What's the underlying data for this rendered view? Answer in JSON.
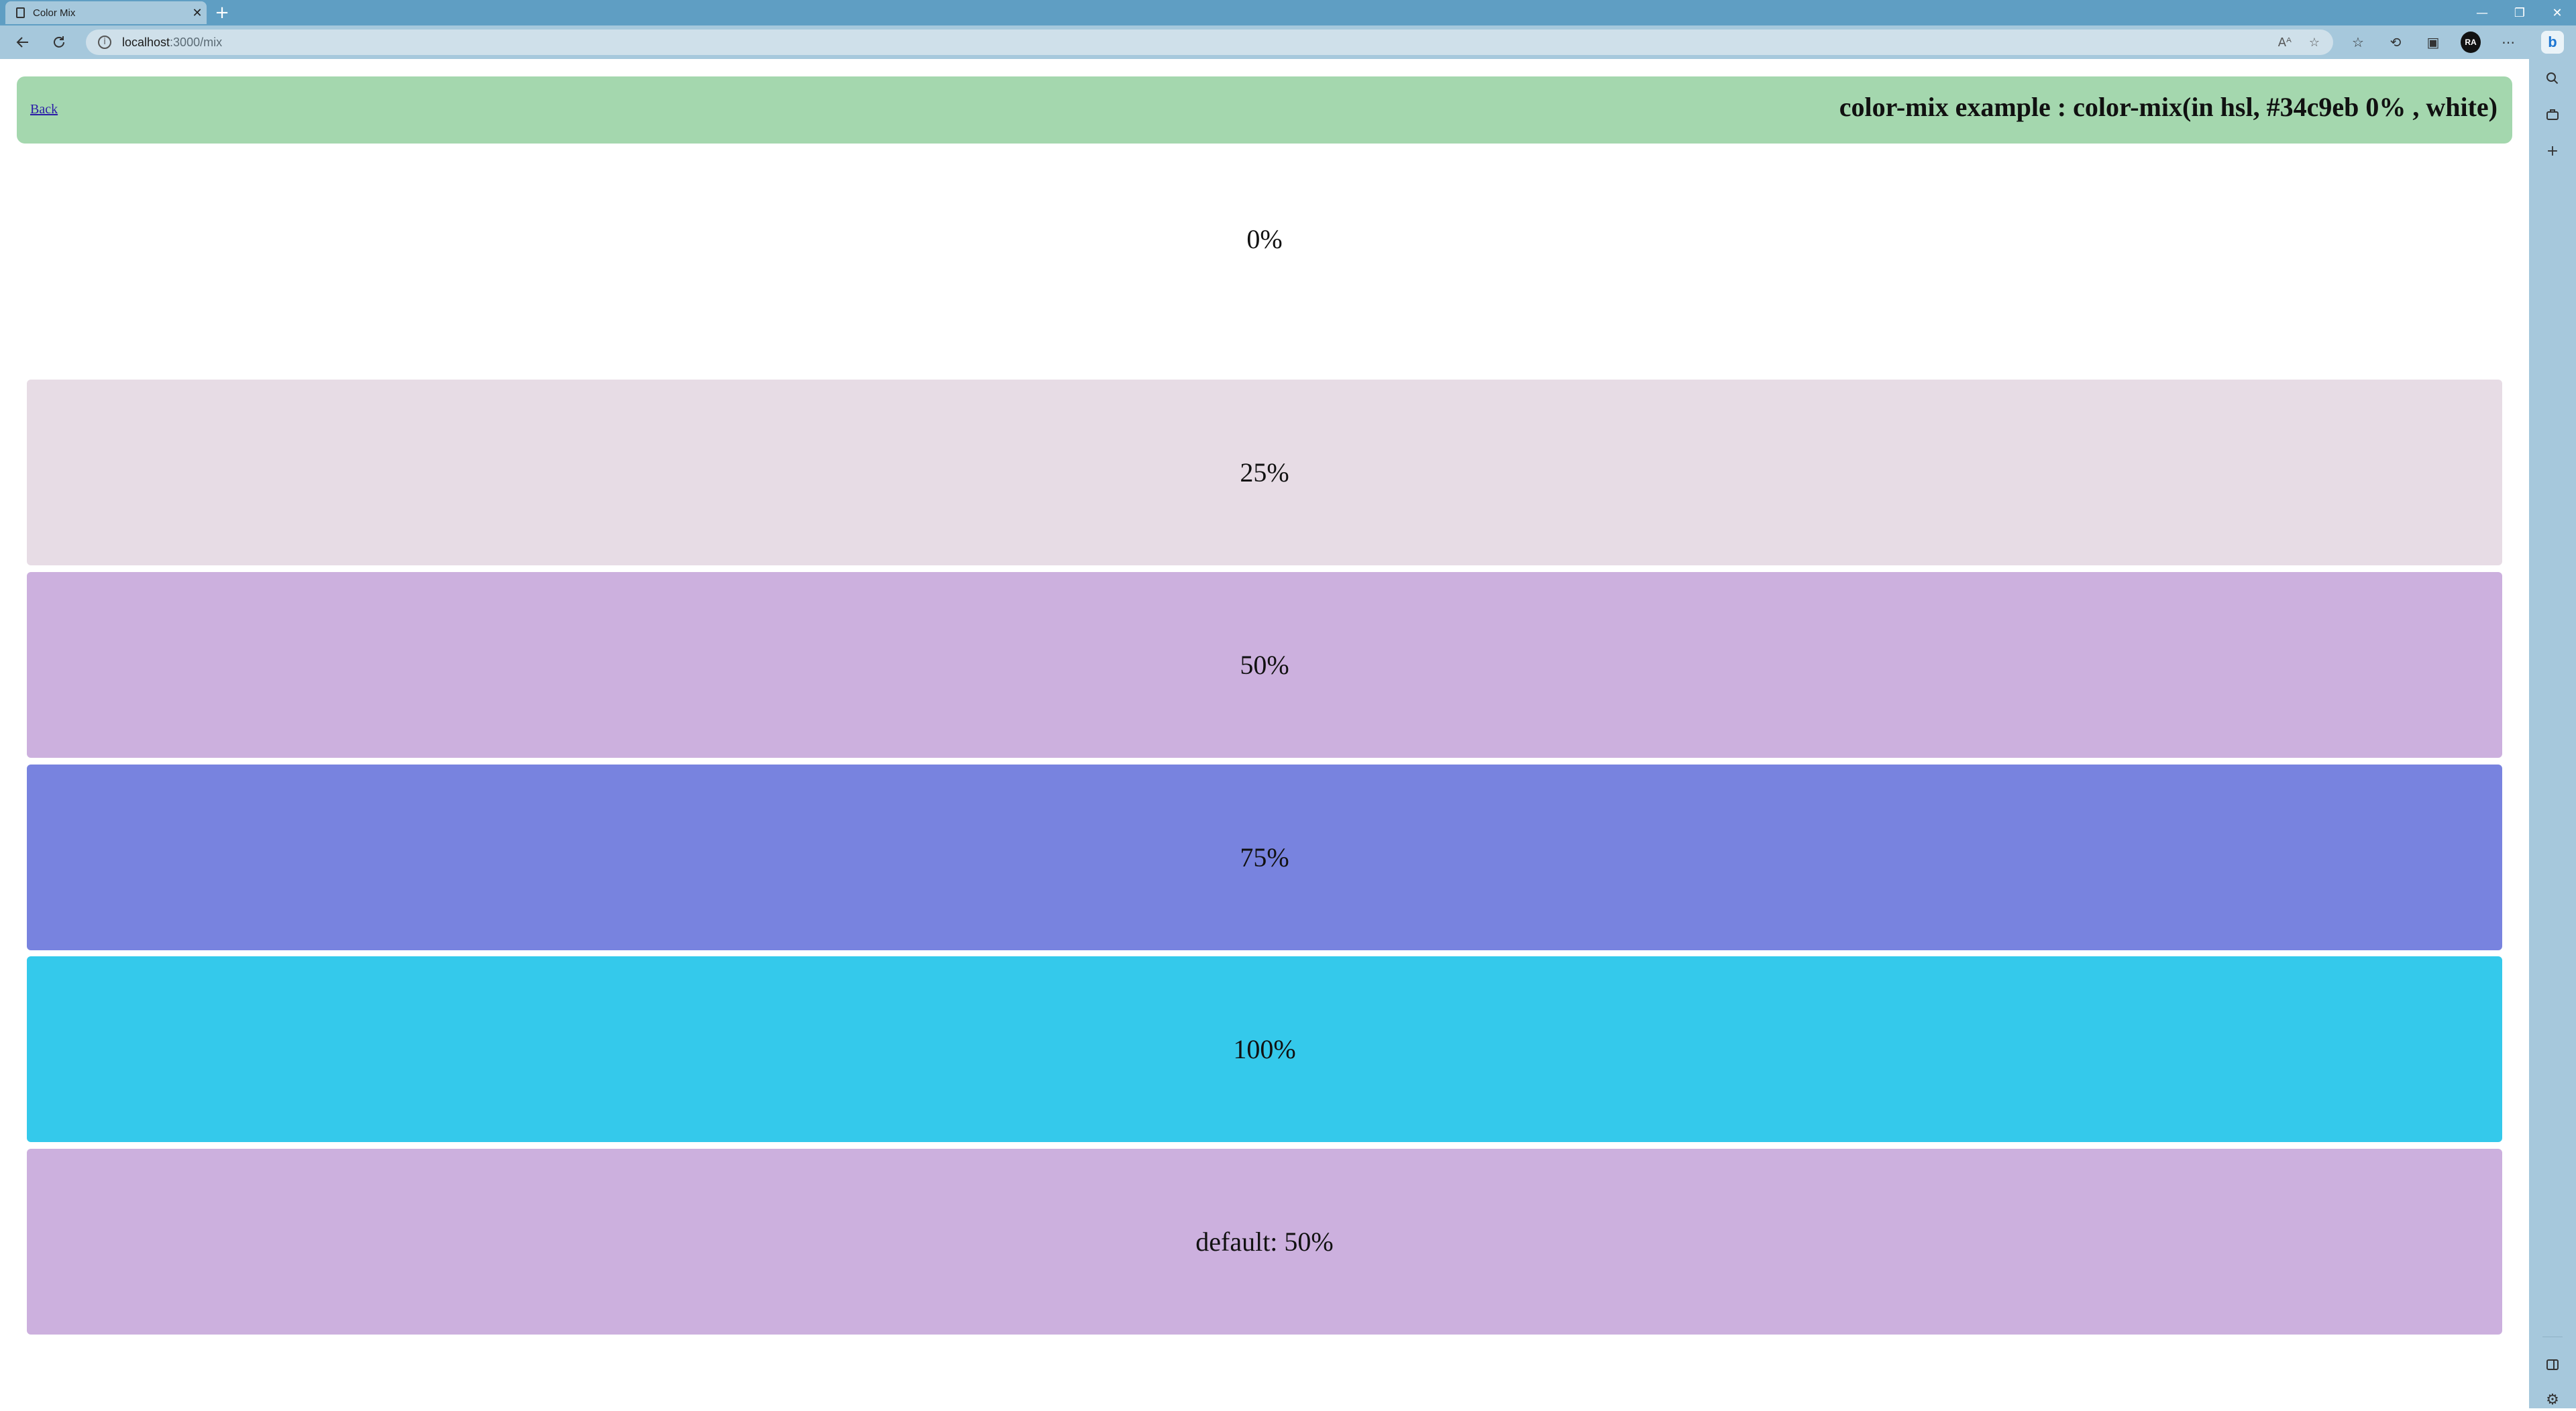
{
  "browser": {
    "tab_title": "Color Mix",
    "tab_close": "✕",
    "new_tab": "+",
    "url_host": "localhost",
    "url_path": ":3000/mix",
    "avatar_initials": "RA",
    "window_controls": [
      "—",
      "❐",
      "✕"
    ],
    "rail_logo": "b"
  },
  "header": {
    "back_label": "Back",
    "title": "color-mix example : color-mix(in hsl, #34c9eb 0% , white)"
  },
  "swatches": [
    {
      "label": "0%",
      "color": "#ffffff"
    },
    {
      "label": "25%",
      "color": "#e7dce5"
    },
    {
      "label": "50%",
      "color": "#ccb0de"
    },
    {
      "label": "75%",
      "color": "#7883df"
    },
    {
      "label": "100%",
      "color": "#34c9eb"
    },
    {
      "label": "default: 50%",
      "color": "#ccb0de"
    }
  ],
  "colors": {
    "header_bg": "#a4d7ae",
    "browser_frame": "#5f9ec3",
    "toolbar": "#a6c8dc"
  }
}
